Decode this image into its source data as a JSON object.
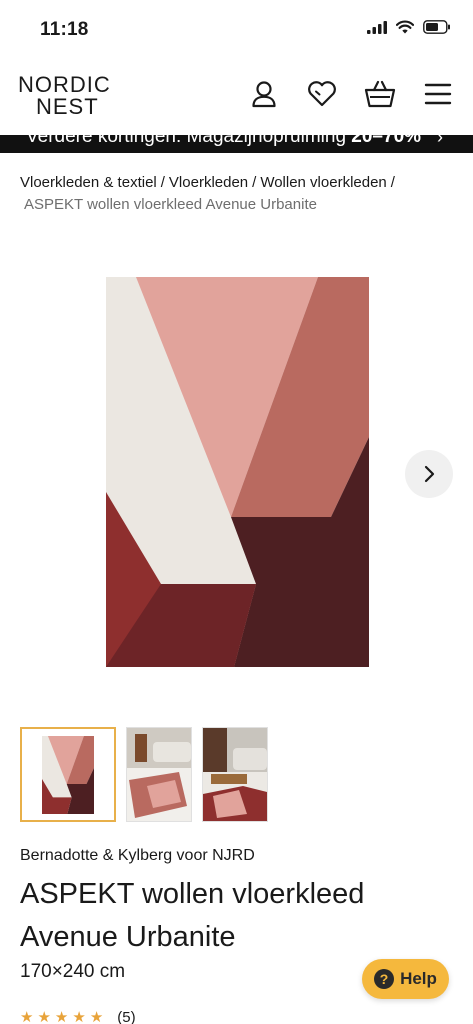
{
  "status_bar": {
    "time": "11:18"
  },
  "header": {
    "logo_line1": "NORDIC",
    "logo_line2": "NEST",
    "icons": [
      "account-icon",
      "wishlist-heart-icon",
      "cart-basket-icon",
      "menu-hamburger-icon"
    ]
  },
  "promo": {
    "text": "Verdere kortingen: Magazijnopruiming",
    "discount": "20–70%",
    "arrow": "›"
  },
  "breadcrumb": {
    "items": [
      "Vloerkleden & textiel",
      "Vloerkleden",
      "Wollen vloerkleden"
    ],
    "separator": "/",
    "current": "ASPEKT wollen vloerkleed Avenue Urbanite"
  },
  "gallery": {
    "thumbnail_count": 3,
    "active_thumbnail": 0,
    "colors": {
      "cream": "#ebe7e1",
      "pink": "#e1a39b",
      "terracotta": "#b96a60",
      "rust": "#8e2f2e",
      "burgundy": "#4d1f22",
      "thumb_active_border": "#e8b04a"
    }
  },
  "product": {
    "brand_prefix": "Bernadotte & Kylberg",
    "brand_connector": "voor",
    "brand_suffix": "NJRD",
    "title": "ASPEKT wollen vloerkleed Avenue Urbanite",
    "size": "170×240 cm",
    "rating": 5,
    "review_count": "(5)"
  },
  "help": {
    "label": "Help",
    "icon_glyph": "?",
    "color": "#f5b83d"
  }
}
